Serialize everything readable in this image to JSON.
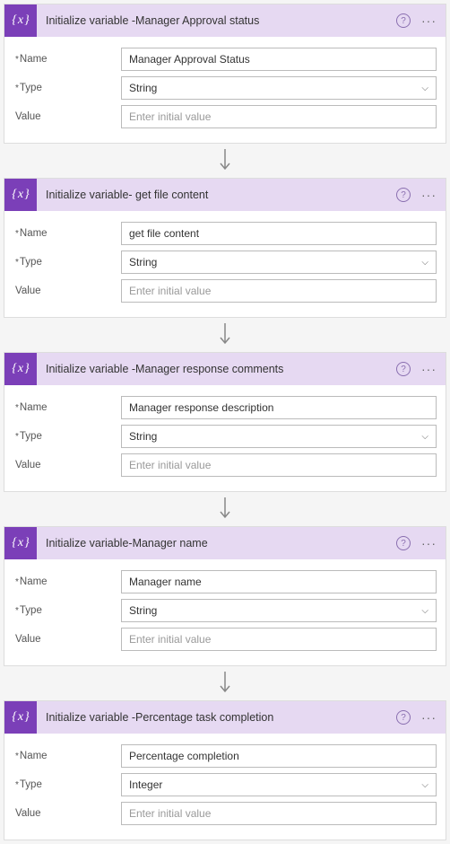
{
  "cards": [
    {
      "title": "Initialize variable -Manager Approval status",
      "name_label": "Name",
      "name_value": "Manager Approval Status",
      "type_label": "Type",
      "type_value": "String",
      "value_label": "Value",
      "value_placeholder": "Enter initial value"
    },
    {
      "title": "Initialize variable- get file content",
      "name_label": "Name",
      "name_value": "get file content",
      "type_label": "Type",
      "type_value": "String",
      "value_label": "Value",
      "value_placeholder": "Enter initial value"
    },
    {
      "title": "Initialize variable -Manager response comments",
      "name_label": "Name",
      "name_value": "Manager response description",
      "type_label": "Type",
      "type_value": "String",
      "value_label": "Value",
      "value_placeholder": "Enter initial value"
    },
    {
      "title": "Initialize variable-Manager name",
      "name_label": "Name",
      "name_value": "Manager name",
      "type_label": "Type",
      "type_value": "String",
      "value_label": "Value",
      "value_placeholder": "Enter initial value"
    },
    {
      "title": "Initialize variable -Percentage task completion",
      "name_label": "Name",
      "name_value": "Percentage completion",
      "type_label": "Type",
      "type_value": "Integer",
      "value_label": "Value",
      "value_placeholder": "Enter initial value"
    }
  ]
}
